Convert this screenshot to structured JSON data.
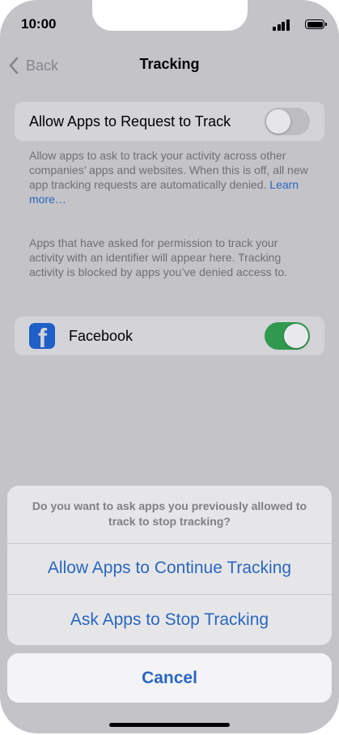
{
  "status_bar": {
    "time": "10:00"
  },
  "nav": {
    "back_label": "Back",
    "title": "Tracking"
  },
  "allow_request": {
    "label": "Allow Apps to Request to Track",
    "enabled": false,
    "footnote": "Allow apps to ask to track your activity across other companies’ apps and websites. When this is off, all new app tracking requests are automatically denied. ",
    "learn_more": "Learn more…"
  },
  "apps_section": {
    "footnote": "Apps that have asked for permission to track your activity with an identifier will appear here. Tracking activity is blocked by apps you’ve denied access to.",
    "apps": [
      {
        "name": "Facebook",
        "icon": "facebook-icon",
        "enabled": true
      }
    ]
  },
  "action_sheet": {
    "message": "Do you want to ask apps you previously allowed to track to stop tracking?",
    "actions": [
      {
        "label": "Allow Apps to Continue Tracking"
      },
      {
        "label": "Ask Apps to Stop Tracking"
      }
    ],
    "cancel_label": "Cancel"
  },
  "colors": {
    "accent": "#2a67c0",
    "switch_on": "#2f9a4f",
    "facebook": "#1f5fc8"
  }
}
